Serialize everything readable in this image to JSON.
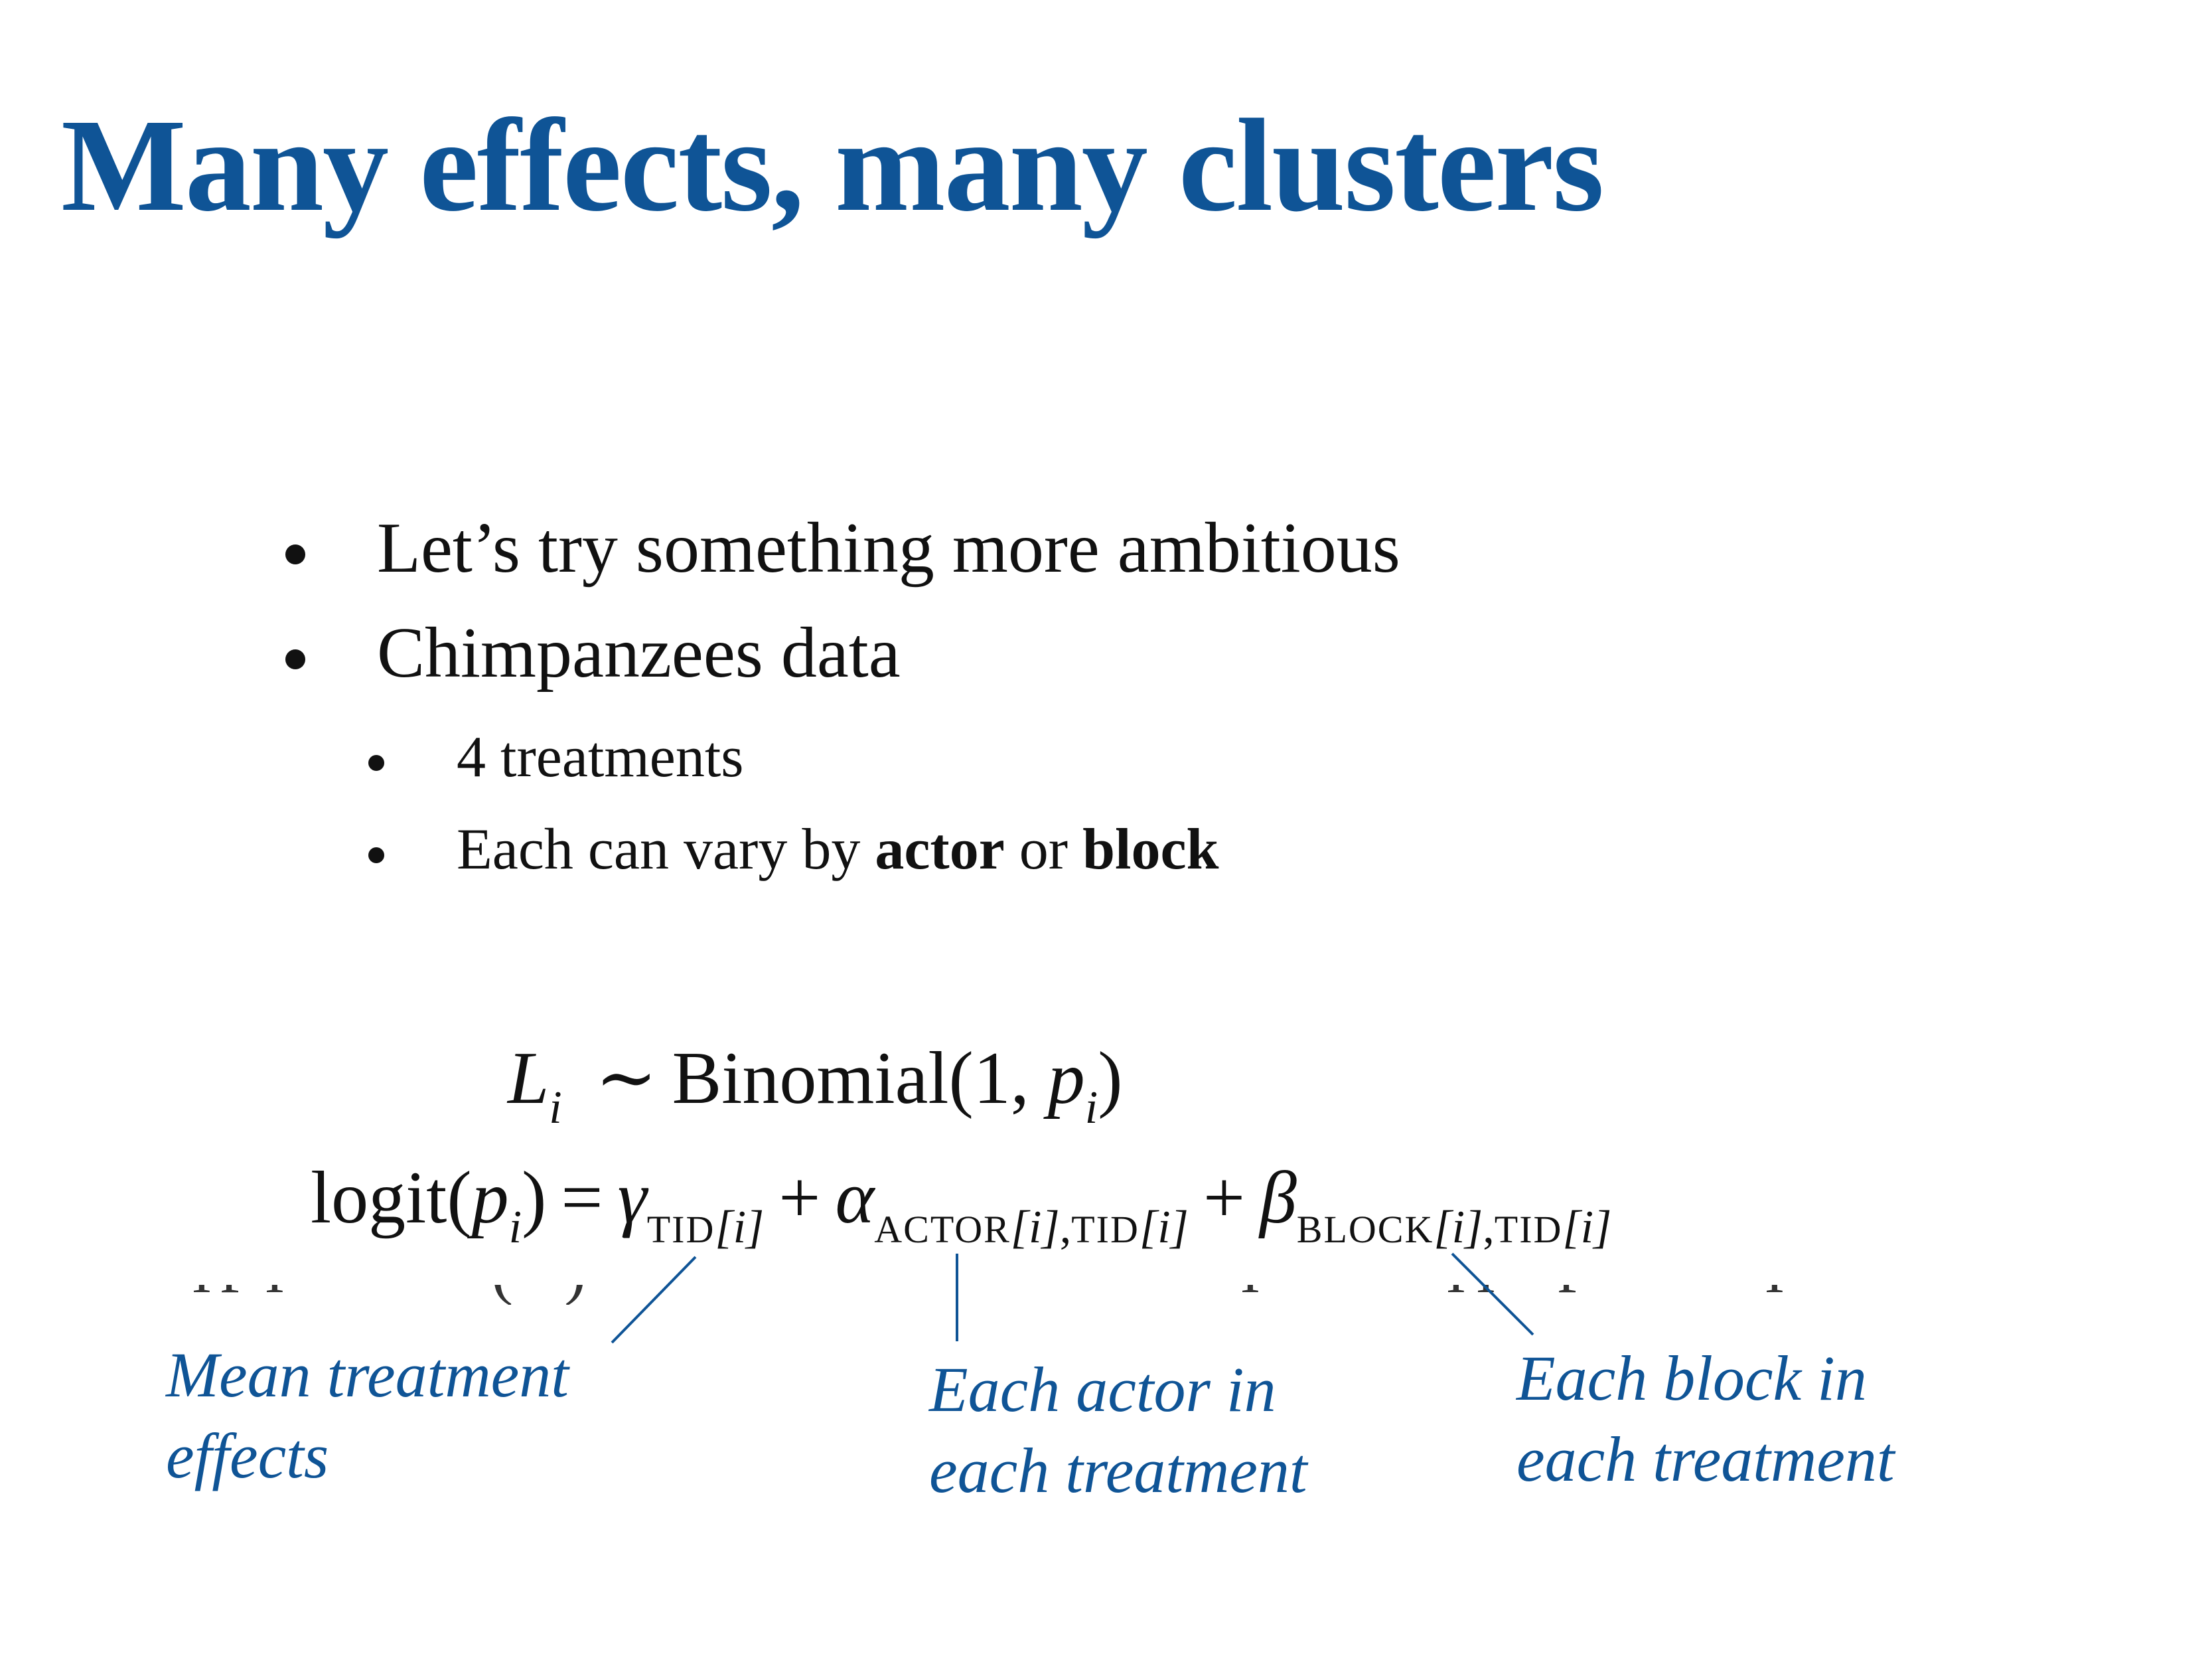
{
  "slide": {
    "title": "Many effects, many clusters",
    "bullets": [
      {
        "text": "Let’s try something more ambitious"
      },
      {
        "text": "Chimpanzees data"
      },
      {
        "text": "4 treatments"
      },
      {
        "pre": "Each can vary by ",
        "bold1": "actor",
        "mid": " or ",
        "bold2": "block"
      }
    ],
    "equation": {
      "line1": {
        "lhs": "L",
        "lhs_sub": "i",
        "rel": "∼",
        "dist": "Binomial(1, ",
        "p": "p",
        "p_sub": "i",
        "close": ")"
      },
      "line2": {
        "fn": "logit(",
        "p": "p",
        "p_sub": "i",
        "close": ")",
        "eq": "=",
        "gamma": "γ",
        "gamma_sub_sc": "TID",
        "idx_i": "[i]",
        "plus": "+",
        "alpha": "α",
        "alpha_sub_sc1": "ACTOR",
        "comma": ",",
        "beta": "β",
        "beta_sub_sc1": "BLOCK"
      }
    },
    "annotations": [
      {
        "line1": "Mean treatment",
        "line2": "effects"
      },
      {
        "line1": "Each actor in",
        "line2": "each treatment"
      },
      {
        "line1": "Each block in",
        "line2": "each treatment"
      }
    ]
  },
  "colors": {
    "accent": "#0f5496",
    "text": "#111111"
  }
}
